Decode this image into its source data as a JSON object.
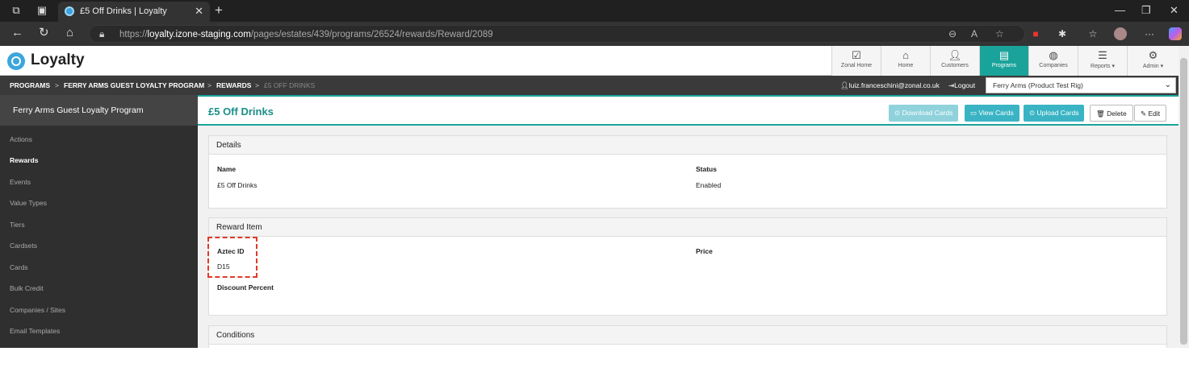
{
  "browser": {
    "tab_title": "£5 Off Drinks | Loyalty",
    "url_prefix": "https://",
    "url_host": "loyalty.izone-staging.com",
    "url_path": "/pages/estates/439/programs/26524/rewards/Reward/2089"
  },
  "app": {
    "title": "Loyalty",
    "nav": [
      {
        "label": "Zonal Home",
        "icon": "check-badge-icon"
      },
      {
        "label": "Home",
        "icon": "home-icon"
      },
      {
        "label": "Customers",
        "icon": "user-icon"
      },
      {
        "label": "Programs",
        "icon": "book-icon",
        "active": true
      },
      {
        "label": "Companies",
        "icon": "globe-icon"
      },
      {
        "label": "Reports ▾",
        "icon": "list-icon"
      },
      {
        "label": "Admin ▾",
        "icon": "gear-icon"
      }
    ],
    "accent_color": "#1aa39a"
  },
  "breadcrumb": {
    "items": [
      "PROGRAMS",
      "FERRY ARMS GUEST LOYALTY PROGRAM",
      "REWARDS",
      "£5 OFF DRINKS"
    ],
    "separator": ">"
  },
  "user": {
    "email": "luiz.franceschini@zonal.co.uk",
    "logout": "Logout",
    "site": "Ferry Arms (Product Test Rig)"
  },
  "sidebar": {
    "heading": "Ferry Arms Guest Loyalty Program",
    "items": [
      "Actions",
      "Rewards",
      "Events",
      "Value Types",
      "Tiers",
      "Cardsets",
      "Cards",
      "Bulk Credit",
      "Companies / Sites",
      "Email Templates"
    ]
  },
  "page": {
    "title": "£5 Off Drinks",
    "buttons": {
      "download": "Download Cards",
      "view": "View Cards",
      "upload": "Upload Cards",
      "delete": "Delete",
      "edit": "Edit"
    }
  },
  "details": {
    "title": "Details",
    "name_label": "Name",
    "name_value": "£5 Off Drinks",
    "status_label": "Status",
    "status_value": "Enabled"
  },
  "reward_item": {
    "title": "Reward Item",
    "aztec_label": "Aztec ID",
    "aztec_value": "D15",
    "price_label": "Price",
    "discount_label": "Discount Percent"
  },
  "conditions": {
    "title": "Conditions"
  }
}
